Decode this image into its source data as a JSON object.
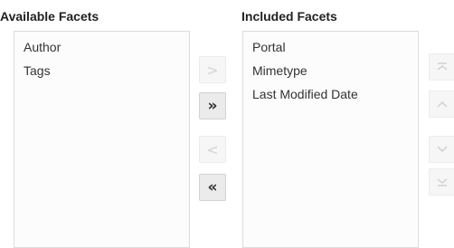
{
  "available": {
    "heading": "Available Facets",
    "items": [
      "Author",
      "Tags"
    ]
  },
  "included": {
    "heading": "Included Facets",
    "items": [
      "Portal",
      "Mimetype",
      "Last Modified Date"
    ]
  },
  "shuttle_buttons": {
    "move_right": {
      "glyph": ">",
      "enabled": false
    },
    "move_all_right": {
      "glyph": "»",
      "enabled": true
    },
    "move_left": {
      "glyph": "<",
      "enabled": false
    },
    "move_all_left": {
      "glyph": "«",
      "enabled": true
    }
  },
  "reorder_buttons": {
    "move_top": {
      "icon": "move-to-top-icon",
      "enabled": false
    },
    "move_up": {
      "icon": "chevron-up-icon",
      "enabled": false
    },
    "move_down": {
      "icon": "chevron-down-icon",
      "enabled": false
    },
    "move_bottom": {
      "icon": "move-to-bottom-icon",
      "enabled": false
    }
  },
  "colors": {
    "enabled_button_bg": "#ebebeb",
    "disabled_button_bg": "#f6f6f6",
    "disabled_glyph": "#d4d4d4",
    "list_border": "#dcdcdc"
  }
}
